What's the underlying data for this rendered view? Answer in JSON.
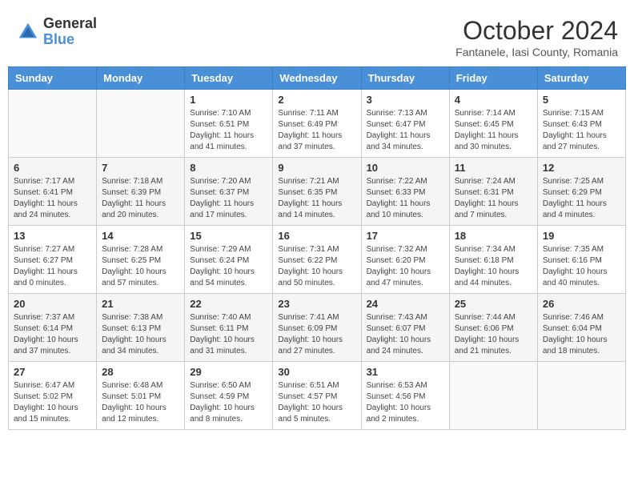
{
  "header": {
    "logo_general": "General",
    "logo_blue": "Blue",
    "month_title": "October 2024",
    "subtitle": "Fantanele, Iasi County, Romania"
  },
  "weekdays": [
    "Sunday",
    "Monday",
    "Tuesday",
    "Wednesday",
    "Thursday",
    "Friday",
    "Saturday"
  ],
  "weeks": [
    [
      {
        "day": "",
        "info": ""
      },
      {
        "day": "",
        "info": ""
      },
      {
        "day": "1",
        "info": "Sunrise: 7:10 AM\nSunset: 6:51 PM\nDaylight: 11 hours and 41 minutes."
      },
      {
        "day": "2",
        "info": "Sunrise: 7:11 AM\nSunset: 6:49 PM\nDaylight: 11 hours and 37 minutes."
      },
      {
        "day": "3",
        "info": "Sunrise: 7:13 AM\nSunset: 6:47 PM\nDaylight: 11 hours and 34 minutes."
      },
      {
        "day": "4",
        "info": "Sunrise: 7:14 AM\nSunset: 6:45 PM\nDaylight: 11 hours and 30 minutes."
      },
      {
        "day": "5",
        "info": "Sunrise: 7:15 AM\nSunset: 6:43 PM\nDaylight: 11 hours and 27 minutes."
      }
    ],
    [
      {
        "day": "6",
        "info": "Sunrise: 7:17 AM\nSunset: 6:41 PM\nDaylight: 11 hours and 24 minutes."
      },
      {
        "day": "7",
        "info": "Sunrise: 7:18 AM\nSunset: 6:39 PM\nDaylight: 11 hours and 20 minutes."
      },
      {
        "day": "8",
        "info": "Sunrise: 7:20 AM\nSunset: 6:37 PM\nDaylight: 11 hours and 17 minutes."
      },
      {
        "day": "9",
        "info": "Sunrise: 7:21 AM\nSunset: 6:35 PM\nDaylight: 11 hours and 14 minutes."
      },
      {
        "day": "10",
        "info": "Sunrise: 7:22 AM\nSunset: 6:33 PM\nDaylight: 11 hours and 10 minutes."
      },
      {
        "day": "11",
        "info": "Sunrise: 7:24 AM\nSunset: 6:31 PM\nDaylight: 11 hours and 7 minutes."
      },
      {
        "day": "12",
        "info": "Sunrise: 7:25 AM\nSunset: 6:29 PM\nDaylight: 11 hours and 4 minutes."
      }
    ],
    [
      {
        "day": "13",
        "info": "Sunrise: 7:27 AM\nSunset: 6:27 PM\nDaylight: 11 hours and 0 minutes."
      },
      {
        "day": "14",
        "info": "Sunrise: 7:28 AM\nSunset: 6:25 PM\nDaylight: 10 hours and 57 minutes."
      },
      {
        "day": "15",
        "info": "Sunrise: 7:29 AM\nSunset: 6:24 PM\nDaylight: 10 hours and 54 minutes."
      },
      {
        "day": "16",
        "info": "Sunrise: 7:31 AM\nSunset: 6:22 PM\nDaylight: 10 hours and 50 minutes."
      },
      {
        "day": "17",
        "info": "Sunrise: 7:32 AM\nSunset: 6:20 PM\nDaylight: 10 hours and 47 minutes."
      },
      {
        "day": "18",
        "info": "Sunrise: 7:34 AM\nSunset: 6:18 PM\nDaylight: 10 hours and 44 minutes."
      },
      {
        "day": "19",
        "info": "Sunrise: 7:35 AM\nSunset: 6:16 PM\nDaylight: 10 hours and 40 minutes."
      }
    ],
    [
      {
        "day": "20",
        "info": "Sunrise: 7:37 AM\nSunset: 6:14 PM\nDaylight: 10 hours and 37 minutes."
      },
      {
        "day": "21",
        "info": "Sunrise: 7:38 AM\nSunset: 6:13 PM\nDaylight: 10 hours and 34 minutes."
      },
      {
        "day": "22",
        "info": "Sunrise: 7:40 AM\nSunset: 6:11 PM\nDaylight: 10 hours and 31 minutes."
      },
      {
        "day": "23",
        "info": "Sunrise: 7:41 AM\nSunset: 6:09 PM\nDaylight: 10 hours and 27 minutes."
      },
      {
        "day": "24",
        "info": "Sunrise: 7:43 AM\nSunset: 6:07 PM\nDaylight: 10 hours and 24 minutes."
      },
      {
        "day": "25",
        "info": "Sunrise: 7:44 AM\nSunset: 6:06 PM\nDaylight: 10 hours and 21 minutes."
      },
      {
        "day": "26",
        "info": "Sunrise: 7:46 AM\nSunset: 6:04 PM\nDaylight: 10 hours and 18 minutes."
      }
    ],
    [
      {
        "day": "27",
        "info": "Sunrise: 6:47 AM\nSunset: 5:02 PM\nDaylight: 10 hours and 15 minutes."
      },
      {
        "day": "28",
        "info": "Sunrise: 6:48 AM\nSunset: 5:01 PM\nDaylight: 10 hours and 12 minutes."
      },
      {
        "day": "29",
        "info": "Sunrise: 6:50 AM\nSunset: 4:59 PM\nDaylight: 10 hours and 8 minutes."
      },
      {
        "day": "30",
        "info": "Sunrise: 6:51 AM\nSunset: 4:57 PM\nDaylight: 10 hours and 5 minutes."
      },
      {
        "day": "31",
        "info": "Sunrise: 6:53 AM\nSunset: 4:56 PM\nDaylight: 10 hours and 2 minutes."
      },
      {
        "day": "",
        "info": ""
      },
      {
        "day": "",
        "info": ""
      }
    ]
  ]
}
